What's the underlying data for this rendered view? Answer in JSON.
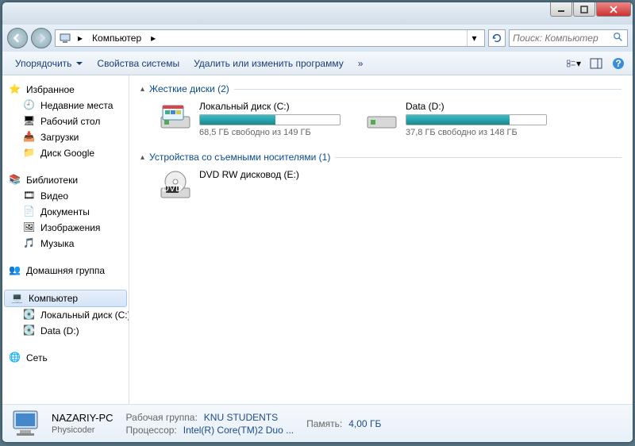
{
  "breadcrumb": {
    "root_icon": "computer",
    "label": "Компьютер"
  },
  "search": {
    "placeholder": "Поиск: Компьютер"
  },
  "toolbar": {
    "organize": "Упорядочить",
    "system_props": "Свойства системы",
    "uninstall": "Удалить или изменить программу",
    "more": "»"
  },
  "sidebar": {
    "favorites": {
      "label": "Избранное",
      "items": [
        "Недавние места",
        "Рабочий стол",
        "Загрузки",
        "Диск Google"
      ]
    },
    "libraries": {
      "label": "Библиотеки",
      "items": [
        "Видео",
        "Документы",
        "Изображения",
        "Музыка"
      ]
    },
    "homegroup": {
      "label": "Домашняя группа"
    },
    "computer": {
      "label": "Компьютер",
      "items": [
        "Локальный диск (C:)",
        "Data (D:)"
      ]
    },
    "network": {
      "label": "Сеть"
    }
  },
  "sections": {
    "hdd": {
      "title": "Жесткие диски (2)"
    },
    "removable": {
      "title": "Устройства со съемными носителями (1)"
    }
  },
  "drives": {
    "c": {
      "name": "Локальный диск (C:)",
      "fill_pct": 54,
      "sub": "68,5 ГБ свободно из 149 ГБ"
    },
    "d": {
      "name": "Data (D:)",
      "fill_pct": 74,
      "sub": "37,8 ГБ свободно из 148 ГБ"
    },
    "dvd": {
      "name": "DVD RW дисковод (E:)"
    }
  },
  "status": {
    "name": "NAZARIY-PC",
    "sub": "Physicoder",
    "workgroup_label": "Рабочая группа:",
    "workgroup": "KNU STUDENTS",
    "cpu_label": "Процессор:",
    "cpu": "Intel(R) Core(TM)2 Duo  ...",
    "mem_label": "Память:",
    "mem": "4,00 ГБ"
  }
}
